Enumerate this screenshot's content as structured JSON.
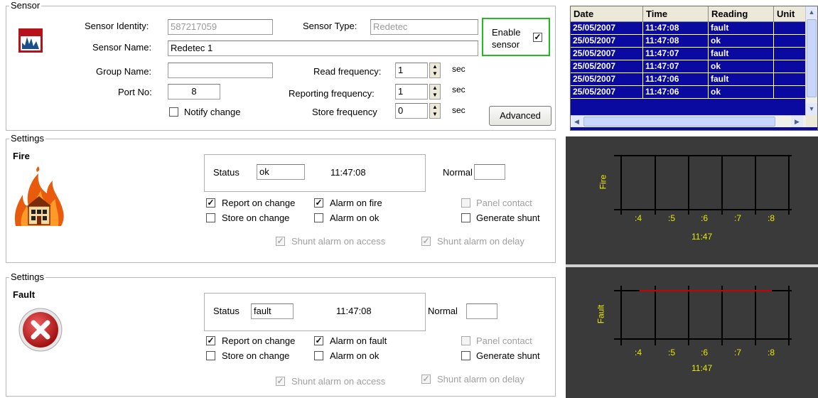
{
  "sensor": {
    "legend": "Sensor",
    "identity_label": "Sensor Identity:",
    "identity_value": "587217059",
    "type_label": "Sensor Type:",
    "type_value": "Redetec",
    "name_label": "Sensor Name:",
    "name_value": "Redetec 1",
    "group_label": "Group Name:",
    "group_value": "",
    "port_label": "Port No:",
    "port_value": "8",
    "notify_label": "Notify change",
    "notify_checked": false,
    "enable_label_1": "Enable",
    "enable_label_2": "sensor",
    "enable_checked": true,
    "read_freq_label": "Read frequency:",
    "read_freq_value": "1",
    "report_freq_label": "Reporting frequency:",
    "report_freq_value": "1",
    "store_freq_label": "Store frequency",
    "store_freq_value": "0",
    "sec_label": "sec",
    "advanced_label": "Advanced"
  },
  "fire": {
    "legend": "Settings",
    "title": "Fire",
    "status_label": "Status",
    "status_value": "ok",
    "time": "11:47:08",
    "normal_label": "Normal",
    "normal_value": "",
    "report_on_change": "Report on change",
    "alarm_on": "Alarm on fire",
    "store_on_change": "Store on change",
    "alarm_on_ok": "Alarm on ok",
    "panel_contact": "Panel contact",
    "generate_shunt": "Generate shunt",
    "shunt_access": "Shunt alarm  on access",
    "shunt_delay": "Shunt alarm  on delay"
  },
  "fault": {
    "legend": "Settings",
    "title": "Fault",
    "status_label": "Status",
    "status_value": "fault",
    "time": "11:47:08",
    "normal_label": "Normal",
    "normal_value": "",
    "report_on_change": "Report on change",
    "alarm_on": "Alarm on fault",
    "store_on_change": "Store on change",
    "alarm_on_ok": "Alarm on ok",
    "panel_contact": "Panel contact",
    "generate_shunt": "Generate shunt",
    "shunt_access": "Shunt alarm  on access",
    "shunt_delay": "Shunt alarm  on delay"
  },
  "log_table": {
    "columns": [
      "Date",
      "Time",
      "Reading",
      "Unit"
    ],
    "rows": [
      [
        "25/05/2007",
        "11:47:08",
        "fault",
        ""
      ],
      [
        "25/05/2007",
        "11:47:08",
        "ok",
        ""
      ],
      [
        "25/05/2007",
        "11:47:07",
        "fault",
        ""
      ],
      [
        "25/05/2007",
        "11:47:07",
        "ok",
        ""
      ],
      [
        "25/05/2007",
        "11:47:06",
        "fault",
        ""
      ],
      [
        "25/05/2007",
        "11:47:06",
        "ok",
        ""
      ]
    ]
  },
  "fire_graph": {
    "axis_label": "Fire",
    "ticks": [
      ":4",
      ":5",
      ":6",
      ":7",
      ":8"
    ],
    "time_label": "11:47"
  },
  "fault_graph": {
    "axis_label": "Fault",
    "ticks": [
      ":4",
      ":5",
      ":6",
      ":7",
      ":8"
    ],
    "time_label": "11:47"
  },
  "colors": {
    "table_bg": "#0a0aa0",
    "graph_bg": "#3a3a3a",
    "graph_text": "#e8e800",
    "fault_line": "#cc0000",
    "enable_border": "#22bb22"
  }
}
